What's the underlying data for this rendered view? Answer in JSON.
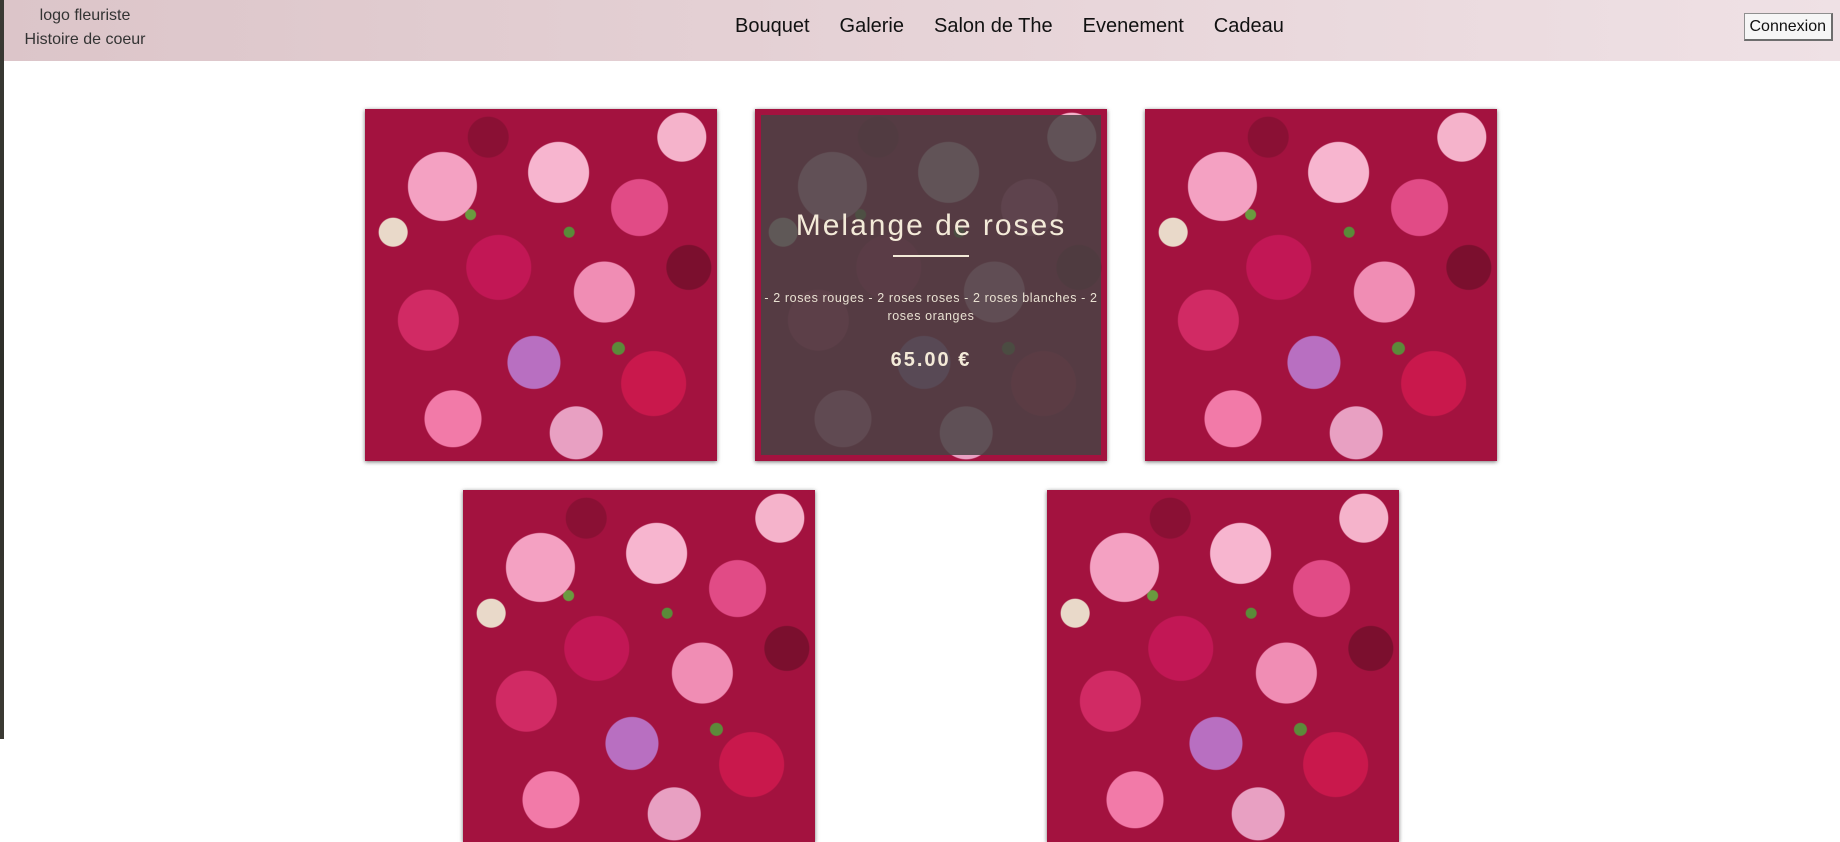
{
  "header": {
    "logo_line1": "logo fleuriste",
    "logo_line2": "Histoire de coeur",
    "nav": [
      "Bouquet",
      "Galerie",
      "Salon de The",
      "Evenement",
      "Cadeau"
    ],
    "login_label": "Connexion"
  },
  "products": [
    {
      "image": "rose-mix-photo"
    },
    {
      "image": "rose-mix-photo",
      "title": "Melange de roses",
      "description": "- 2 roses rouges - 2 roses roses - 2 roses blanches - 2 roses oranges",
      "price": "65.00 €"
    },
    {
      "image": "rose-mix-photo"
    },
    {
      "image": "rose-mix-photo"
    },
    {
      "image": "rose-mix-photo"
    }
  ],
  "colors": {
    "header_gradient_start": "#dcc5c9",
    "header_gradient_end": "#efe1e5",
    "overlay": "#484244",
    "overlay_text": "#f3ead8"
  }
}
